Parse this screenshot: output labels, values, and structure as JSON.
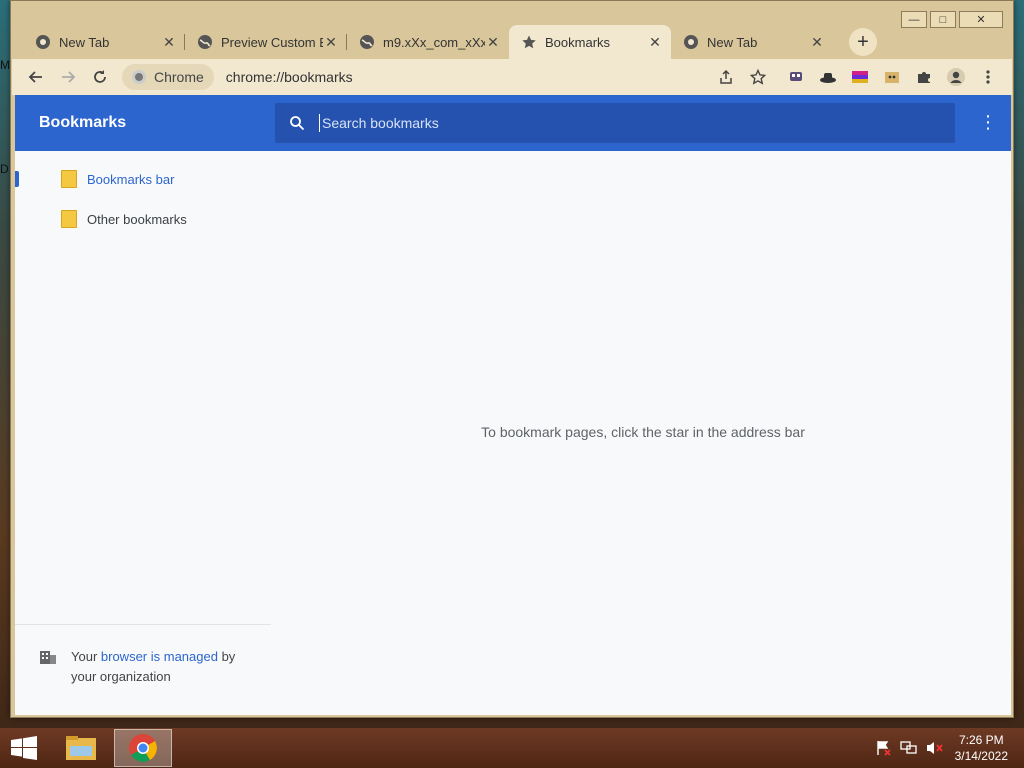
{
  "window": {
    "controls": {
      "minimize": "—",
      "maximize": "□",
      "close": "✕"
    }
  },
  "tabs": [
    {
      "title": "New Tab",
      "icon": "chrome-globe-icon",
      "active": false
    },
    {
      "title": "Preview Custom E",
      "icon": "globe-icon",
      "active": false
    },
    {
      "title": "m9.xXx_com_xXx",
      "icon": "globe-icon",
      "active": false
    },
    {
      "title": "Bookmarks",
      "icon": "star-icon",
      "active": true
    },
    {
      "title": "New Tab",
      "icon": "chrome-globe-icon",
      "active": false
    }
  ],
  "new_tab_label": "+",
  "toolbar": {
    "chip_label": "Chrome",
    "url": "chrome://bookmarks"
  },
  "bookmarks": {
    "title": "Bookmarks",
    "search_placeholder": "Search bookmarks",
    "folders": [
      {
        "label": "Bookmarks bar",
        "selected": true
      },
      {
        "label": "Other bookmarks",
        "selected": false
      }
    ],
    "empty_message": "To bookmark pages, click the star in the address bar",
    "managed": {
      "prefix": "Your ",
      "link": "browser is managed",
      "suffix": " by your organization"
    }
  },
  "desktop_edge": {
    "top_letter": "M",
    "mid_letter": "D"
  },
  "taskbar": {
    "time": "7:26 PM",
    "date": "3/14/2022"
  },
  "colors": {
    "accent": "#2d65cf",
    "search_bg": "#2452ae",
    "frame": "#d9c79b",
    "toolbar": "#f2e8cf"
  }
}
